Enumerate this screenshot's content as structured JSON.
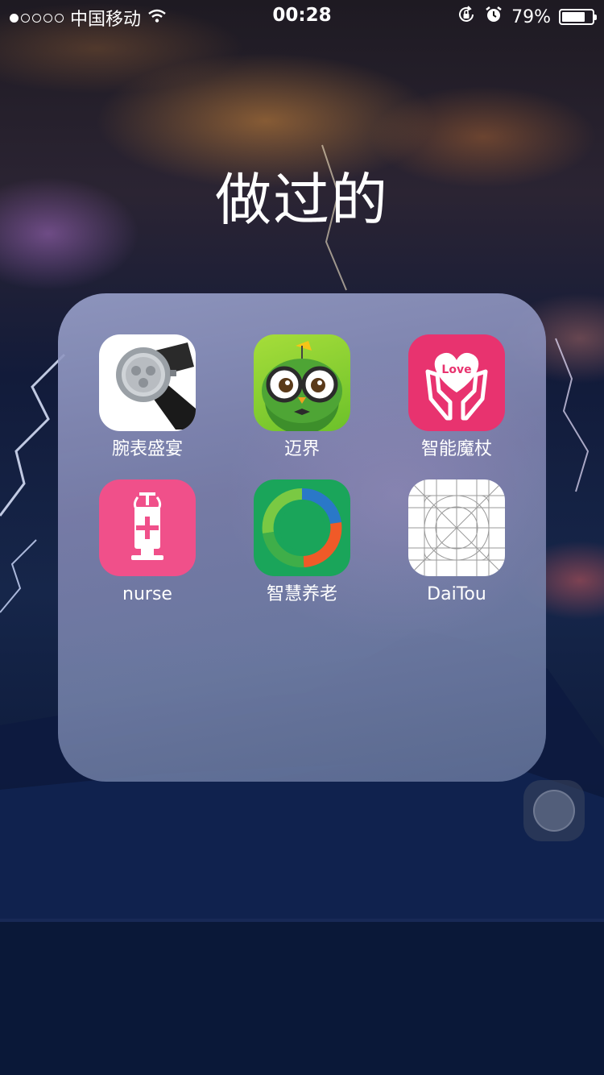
{
  "status_bar": {
    "signal_dots_filled": 1,
    "signal_dots_total": 5,
    "carrier": "中国移动",
    "time": "00:28",
    "battery_percent_text": "79%",
    "battery_level": 0.79
  },
  "folder": {
    "title": "做过的",
    "apps": [
      {
        "label": "腕表盛宴",
        "icon": "watch-icon"
      },
      {
        "label": "迈界",
        "icon": "owl-icon"
      },
      {
        "label": "智能魔杖",
        "icon": "love-hands-icon",
        "icon_text": "Love",
        "color": "#e8336f"
      },
      {
        "label": "nurse",
        "icon": "syringe-icon",
        "color": "#f0508a"
      },
      {
        "label": "智慧养老",
        "icon": "ring-icon",
        "color": "#1aa55a"
      },
      {
        "label": "DaiTou",
        "icon": "grid-template-icon"
      }
    ]
  }
}
